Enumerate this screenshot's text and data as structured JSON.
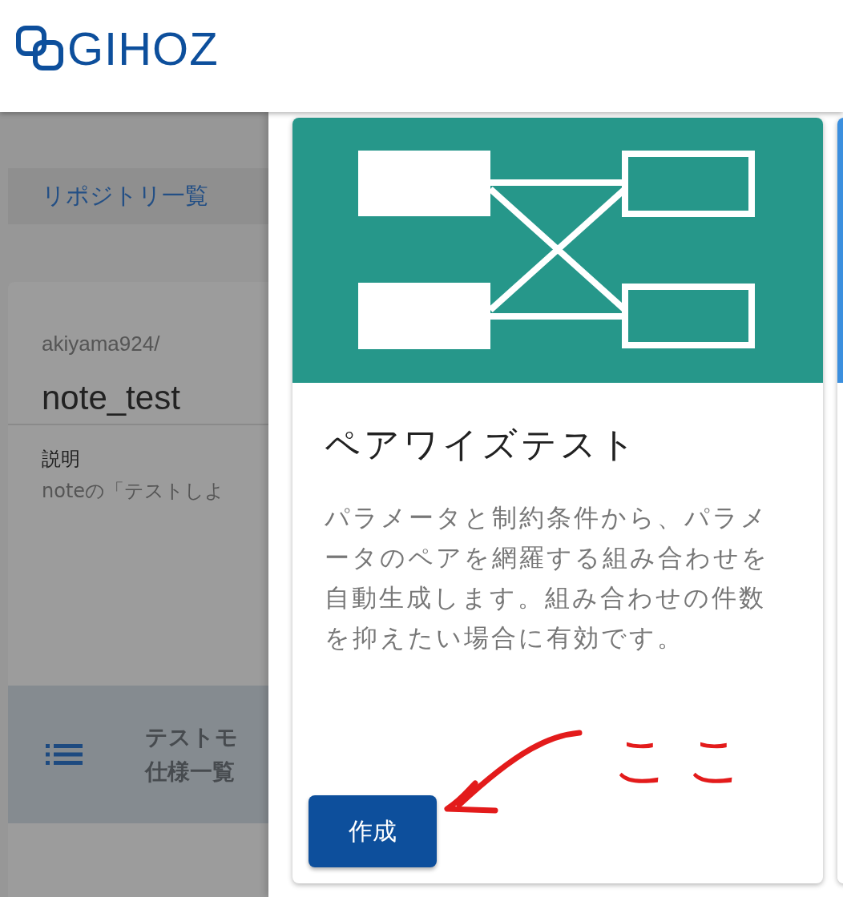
{
  "header": {
    "logo": "GIHOZ"
  },
  "breadcrumb": {
    "label": "リポジトリ一覧"
  },
  "repository": {
    "owner": "akiyama924/",
    "name": "note_test",
    "description_label": "説明",
    "description": "noteの「テストしよ"
  },
  "menu_item": {
    "label_lines": [
      "テストモ",
      "仕様一覧"
    ]
  },
  "tool_card": {
    "title": "ペアワイズテスト",
    "description": "パラメータと制約条件から、パラメータのペアを網羅する組み合わせを自動生成します。組み合わせの件数を抑えたい場合に有効です。",
    "button": "作成"
  },
  "annotation": {
    "text": "ここ"
  }
}
